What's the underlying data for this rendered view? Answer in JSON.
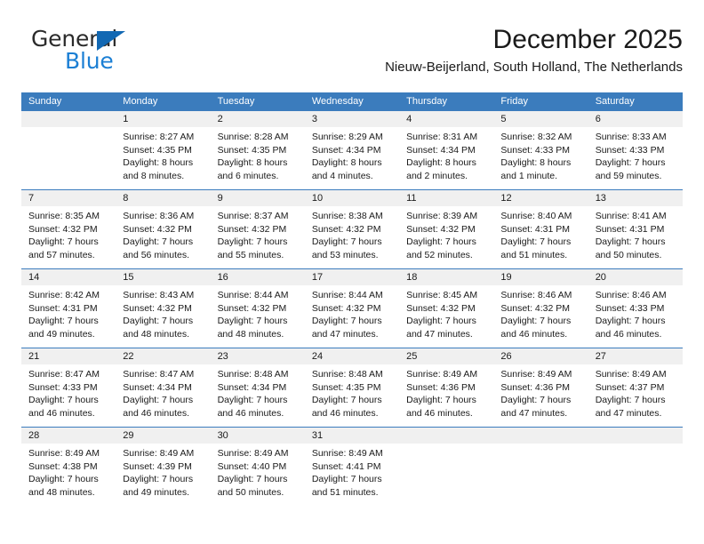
{
  "brand": {
    "name_part1": "General",
    "name_part2": "Blue",
    "triangle_icon": "brand-triangle-icon",
    "colors": {
      "dark": "#2b2b2b",
      "blue": "#1b7fd4",
      "triangle": "#1268b3"
    }
  },
  "header": {
    "title": "December 2025",
    "subtitle": "Nieuw-Beijerland, South Holland, The Netherlands"
  },
  "theme": {
    "header_blue": "#3b7cbd",
    "day_band_gray": "#f0f0f0",
    "text": "#1a1a1a"
  },
  "calendar": {
    "weekdays": [
      "Sunday",
      "Monday",
      "Tuesday",
      "Wednesday",
      "Thursday",
      "Friday",
      "Saturday"
    ],
    "weeks": [
      [
        {
          "day": "",
          "empty": true,
          "sunrise": "",
          "sunset": "",
          "daylight_line1": "",
          "daylight_line2": ""
        },
        {
          "day": "1",
          "empty": false,
          "sunrise": "Sunrise: 8:27 AM",
          "sunset": "Sunset: 4:35 PM",
          "daylight_line1": "Daylight: 8 hours",
          "daylight_line2": "and 8 minutes."
        },
        {
          "day": "2",
          "empty": false,
          "sunrise": "Sunrise: 8:28 AM",
          "sunset": "Sunset: 4:35 PM",
          "daylight_line1": "Daylight: 8 hours",
          "daylight_line2": "and 6 minutes."
        },
        {
          "day": "3",
          "empty": false,
          "sunrise": "Sunrise: 8:29 AM",
          "sunset": "Sunset: 4:34 PM",
          "daylight_line1": "Daylight: 8 hours",
          "daylight_line2": "and 4 minutes."
        },
        {
          "day": "4",
          "empty": false,
          "sunrise": "Sunrise: 8:31 AM",
          "sunset": "Sunset: 4:34 PM",
          "daylight_line1": "Daylight: 8 hours",
          "daylight_line2": "and 2 minutes."
        },
        {
          "day": "5",
          "empty": false,
          "sunrise": "Sunrise: 8:32 AM",
          "sunset": "Sunset: 4:33 PM",
          "daylight_line1": "Daylight: 8 hours",
          "daylight_line2": "and 1 minute."
        },
        {
          "day": "6",
          "empty": false,
          "sunrise": "Sunrise: 8:33 AM",
          "sunset": "Sunset: 4:33 PM",
          "daylight_line1": "Daylight: 7 hours",
          "daylight_line2": "and 59 minutes."
        }
      ],
      [
        {
          "day": "7",
          "empty": false,
          "sunrise": "Sunrise: 8:35 AM",
          "sunset": "Sunset: 4:32 PM",
          "daylight_line1": "Daylight: 7 hours",
          "daylight_line2": "and 57 minutes."
        },
        {
          "day": "8",
          "empty": false,
          "sunrise": "Sunrise: 8:36 AM",
          "sunset": "Sunset: 4:32 PM",
          "daylight_line1": "Daylight: 7 hours",
          "daylight_line2": "and 56 minutes."
        },
        {
          "day": "9",
          "empty": false,
          "sunrise": "Sunrise: 8:37 AM",
          "sunset": "Sunset: 4:32 PM",
          "daylight_line1": "Daylight: 7 hours",
          "daylight_line2": "and 55 minutes."
        },
        {
          "day": "10",
          "empty": false,
          "sunrise": "Sunrise: 8:38 AM",
          "sunset": "Sunset: 4:32 PM",
          "daylight_line1": "Daylight: 7 hours",
          "daylight_line2": "and 53 minutes."
        },
        {
          "day": "11",
          "empty": false,
          "sunrise": "Sunrise: 8:39 AM",
          "sunset": "Sunset: 4:32 PM",
          "daylight_line1": "Daylight: 7 hours",
          "daylight_line2": "and 52 minutes."
        },
        {
          "day": "12",
          "empty": false,
          "sunrise": "Sunrise: 8:40 AM",
          "sunset": "Sunset: 4:31 PM",
          "daylight_line1": "Daylight: 7 hours",
          "daylight_line2": "and 51 minutes."
        },
        {
          "day": "13",
          "empty": false,
          "sunrise": "Sunrise: 8:41 AM",
          "sunset": "Sunset: 4:31 PM",
          "daylight_line1": "Daylight: 7 hours",
          "daylight_line2": "and 50 minutes."
        }
      ],
      [
        {
          "day": "14",
          "empty": false,
          "sunrise": "Sunrise: 8:42 AM",
          "sunset": "Sunset: 4:31 PM",
          "daylight_line1": "Daylight: 7 hours",
          "daylight_line2": "and 49 minutes."
        },
        {
          "day": "15",
          "empty": false,
          "sunrise": "Sunrise: 8:43 AM",
          "sunset": "Sunset: 4:32 PM",
          "daylight_line1": "Daylight: 7 hours",
          "daylight_line2": "and 48 minutes."
        },
        {
          "day": "16",
          "empty": false,
          "sunrise": "Sunrise: 8:44 AM",
          "sunset": "Sunset: 4:32 PM",
          "daylight_line1": "Daylight: 7 hours",
          "daylight_line2": "and 48 minutes."
        },
        {
          "day": "17",
          "empty": false,
          "sunrise": "Sunrise: 8:44 AM",
          "sunset": "Sunset: 4:32 PM",
          "daylight_line1": "Daylight: 7 hours",
          "daylight_line2": "and 47 minutes."
        },
        {
          "day": "18",
          "empty": false,
          "sunrise": "Sunrise: 8:45 AM",
          "sunset": "Sunset: 4:32 PM",
          "daylight_line1": "Daylight: 7 hours",
          "daylight_line2": "and 47 minutes."
        },
        {
          "day": "19",
          "empty": false,
          "sunrise": "Sunrise: 8:46 AM",
          "sunset": "Sunset: 4:32 PM",
          "daylight_line1": "Daylight: 7 hours",
          "daylight_line2": "and 46 minutes."
        },
        {
          "day": "20",
          "empty": false,
          "sunrise": "Sunrise: 8:46 AM",
          "sunset": "Sunset: 4:33 PM",
          "daylight_line1": "Daylight: 7 hours",
          "daylight_line2": "and 46 minutes."
        }
      ],
      [
        {
          "day": "21",
          "empty": false,
          "sunrise": "Sunrise: 8:47 AM",
          "sunset": "Sunset: 4:33 PM",
          "daylight_line1": "Daylight: 7 hours",
          "daylight_line2": "and 46 minutes."
        },
        {
          "day": "22",
          "empty": false,
          "sunrise": "Sunrise: 8:47 AM",
          "sunset": "Sunset: 4:34 PM",
          "daylight_line1": "Daylight: 7 hours",
          "daylight_line2": "and 46 minutes."
        },
        {
          "day": "23",
          "empty": false,
          "sunrise": "Sunrise: 8:48 AM",
          "sunset": "Sunset: 4:34 PM",
          "daylight_line1": "Daylight: 7 hours",
          "daylight_line2": "and 46 minutes."
        },
        {
          "day": "24",
          "empty": false,
          "sunrise": "Sunrise: 8:48 AM",
          "sunset": "Sunset: 4:35 PM",
          "daylight_line1": "Daylight: 7 hours",
          "daylight_line2": "and 46 minutes."
        },
        {
          "day": "25",
          "empty": false,
          "sunrise": "Sunrise: 8:49 AM",
          "sunset": "Sunset: 4:36 PM",
          "daylight_line1": "Daylight: 7 hours",
          "daylight_line2": "and 46 minutes."
        },
        {
          "day": "26",
          "empty": false,
          "sunrise": "Sunrise: 8:49 AM",
          "sunset": "Sunset: 4:36 PM",
          "daylight_line1": "Daylight: 7 hours",
          "daylight_line2": "and 47 minutes."
        },
        {
          "day": "27",
          "empty": false,
          "sunrise": "Sunrise: 8:49 AM",
          "sunset": "Sunset: 4:37 PM",
          "daylight_line1": "Daylight: 7 hours",
          "daylight_line2": "and 47 minutes."
        }
      ],
      [
        {
          "day": "28",
          "empty": false,
          "sunrise": "Sunrise: 8:49 AM",
          "sunset": "Sunset: 4:38 PM",
          "daylight_line1": "Daylight: 7 hours",
          "daylight_line2": "and 48 minutes."
        },
        {
          "day": "29",
          "empty": false,
          "sunrise": "Sunrise: 8:49 AM",
          "sunset": "Sunset: 4:39 PM",
          "daylight_line1": "Daylight: 7 hours",
          "daylight_line2": "and 49 minutes."
        },
        {
          "day": "30",
          "empty": false,
          "sunrise": "Sunrise: 8:49 AM",
          "sunset": "Sunset: 4:40 PM",
          "daylight_line1": "Daylight: 7 hours",
          "daylight_line2": "and 50 minutes."
        },
        {
          "day": "31",
          "empty": false,
          "sunrise": "Sunrise: 8:49 AM",
          "sunset": "Sunset: 4:41 PM",
          "daylight_line1": "Daylight: 7 hours",
          "daylight_line2": "and 51 minutes."
        },
        {
          "day": "",
          "empty": true,
          "sunrise": "",
          "sunset": "",
          "daylight_line1": "",
          "daylight_line2": ""
        },
        {
          "day": "",
          "empty": true,
          "sunrise": "",
          "sunset": "",
          "daylight_line1": "",
          "daylight_line2": ""
        },
        {
          "day": "",
          "empty": true,
          "sunrise": "",
          "sunset": "",
          "daylight_line1": "",
          "daylight_line2": ""
        }
      ]
    ]
  }
}
